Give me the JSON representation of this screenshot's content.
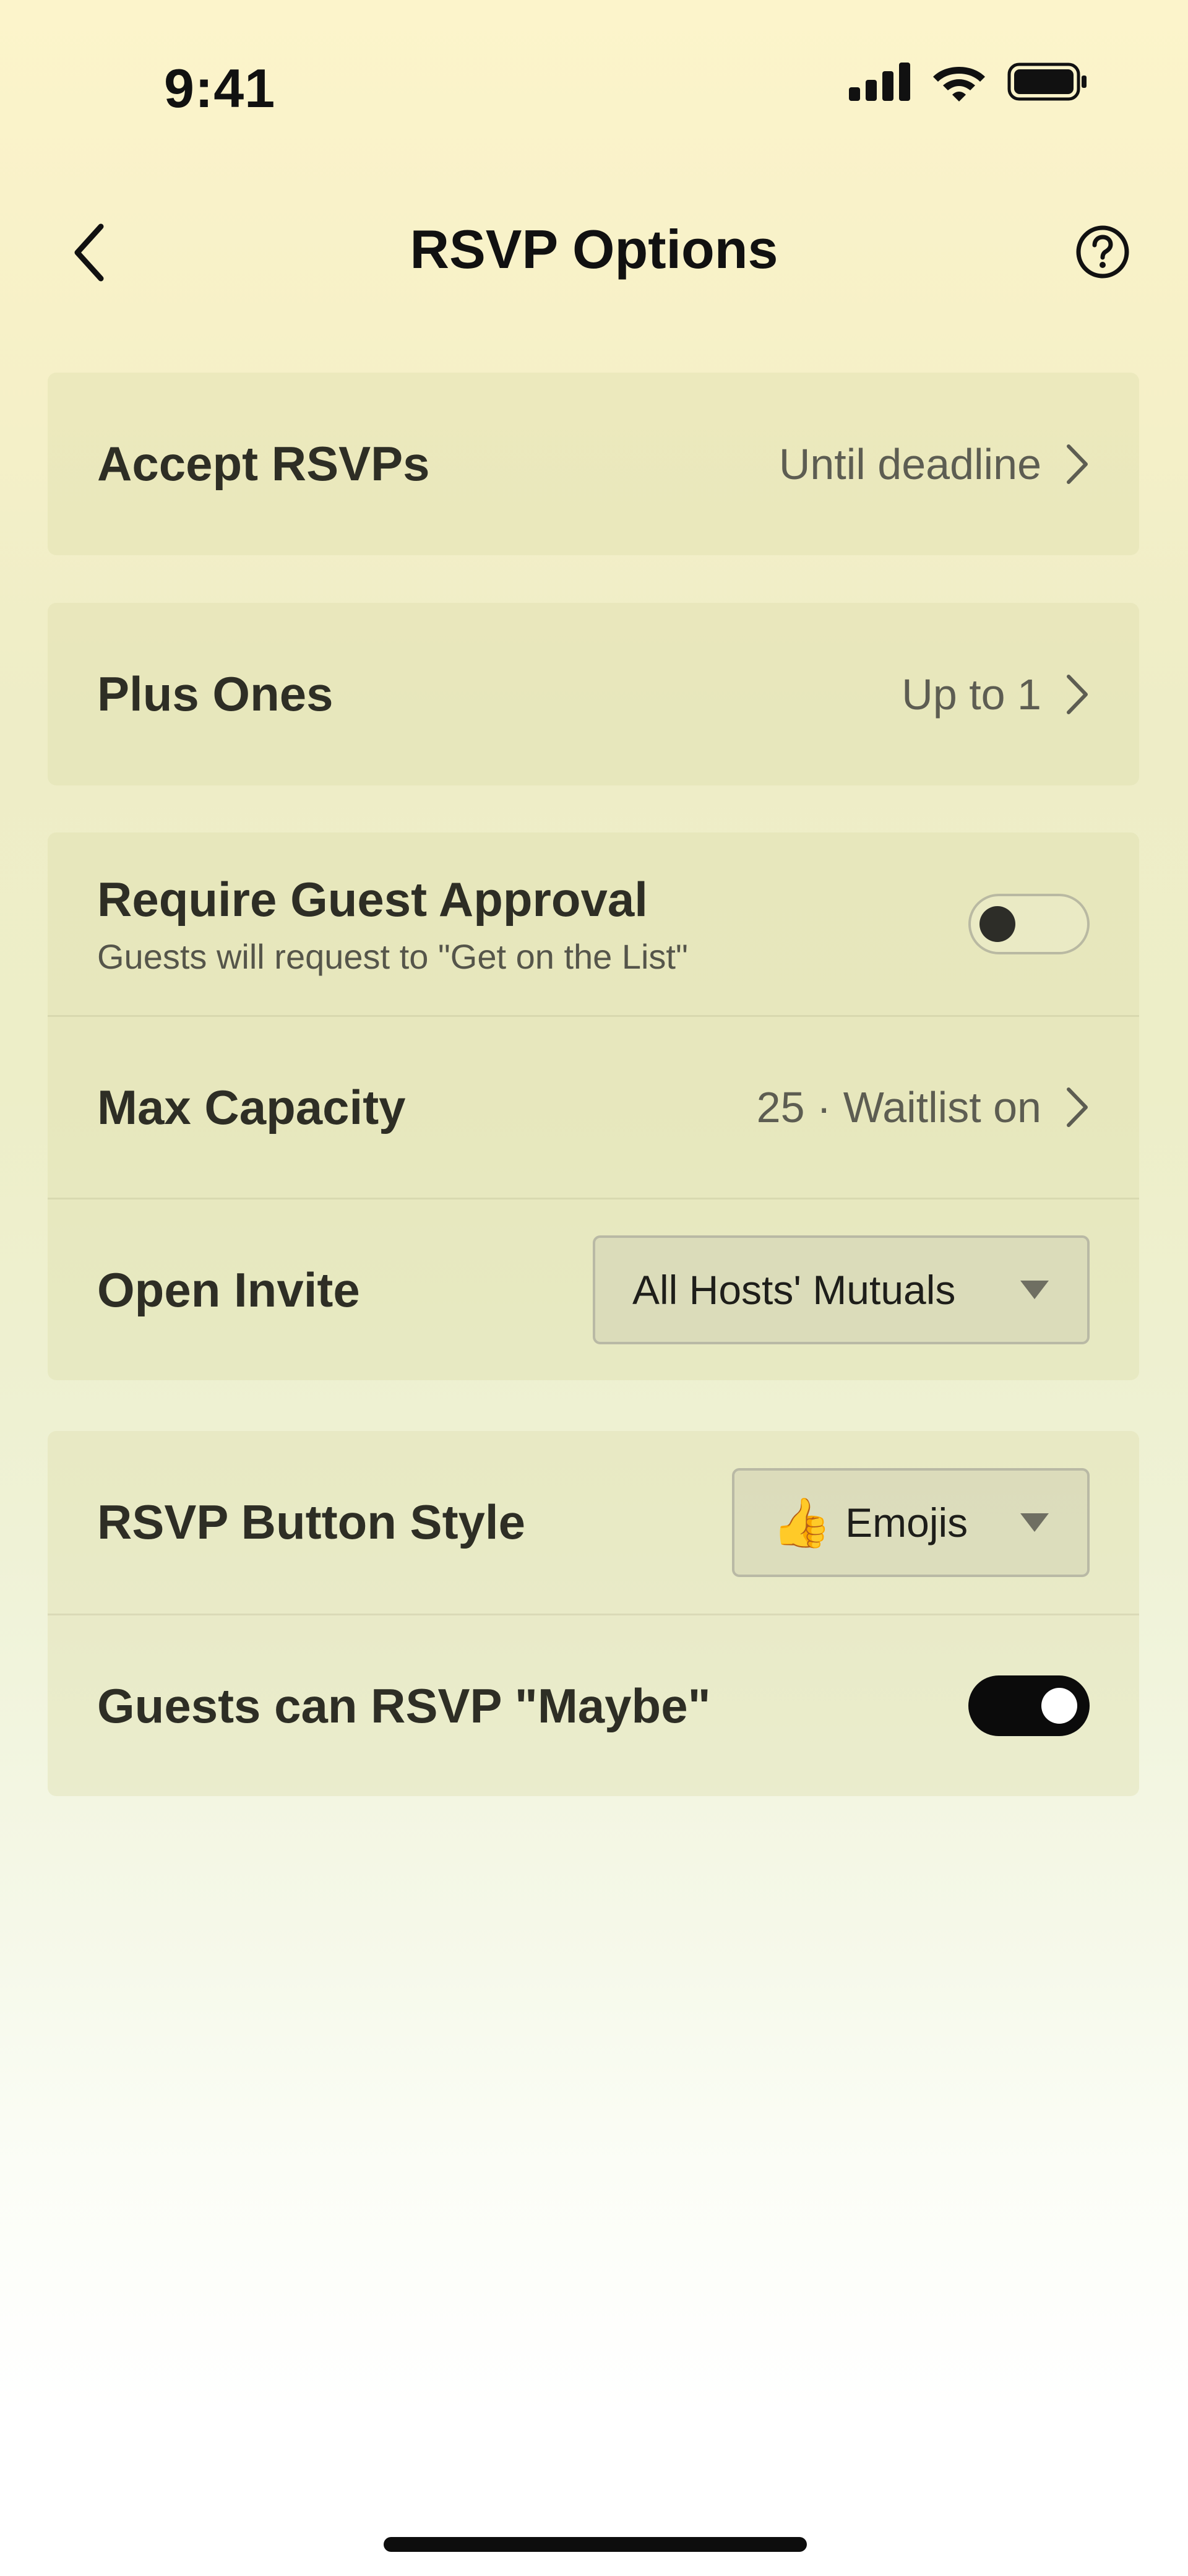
{
  "status_bar": {
    "time": "9:41"
  },
  "nav": {
    "title": "RSVP Options",
    "back_icon": "chevron-left-icon",
    "help_icon": "question-circle-icon"
  },
  "rows": {
    "accept_rsvps": {
      "label": "Accept RSVPs",
      "value": "Until deadline"
    },
    "plus_ones": {
      "label": "Plus Ones",
      "value": "Up to 1"
    },
    "guest_approval": {
      "label": "Require Guest Approval",
      "sublabel": "Guests will request to \"Get on the List\"",
      "toggle_on": false
    },
    "max_capacity": {
      "label": "Max Capacity",
      "value": "25 · Waitlist on"
    },
    "open_invite": {
      "label": "Open Invite",
      "selected": "All Hosts' Mutuals"
    },
    "button_style": {
      "label": "RSVP Button Style",
      "emoji": "👍",
      "selected": "Emojis"
    },
    "maybe": {
      "label": "Guests can RSVP \"Maybe\"",
      "toggle_on": true
    }
  },
  "colors": {
    "background_top": "#fcf4cb",
    "background_bottom": "#ffffff",
    "card": "#e6e3b8",
    "toggle_on": "#0b0b0b",
    "text_primary": "#2e2e25"
  }
}
